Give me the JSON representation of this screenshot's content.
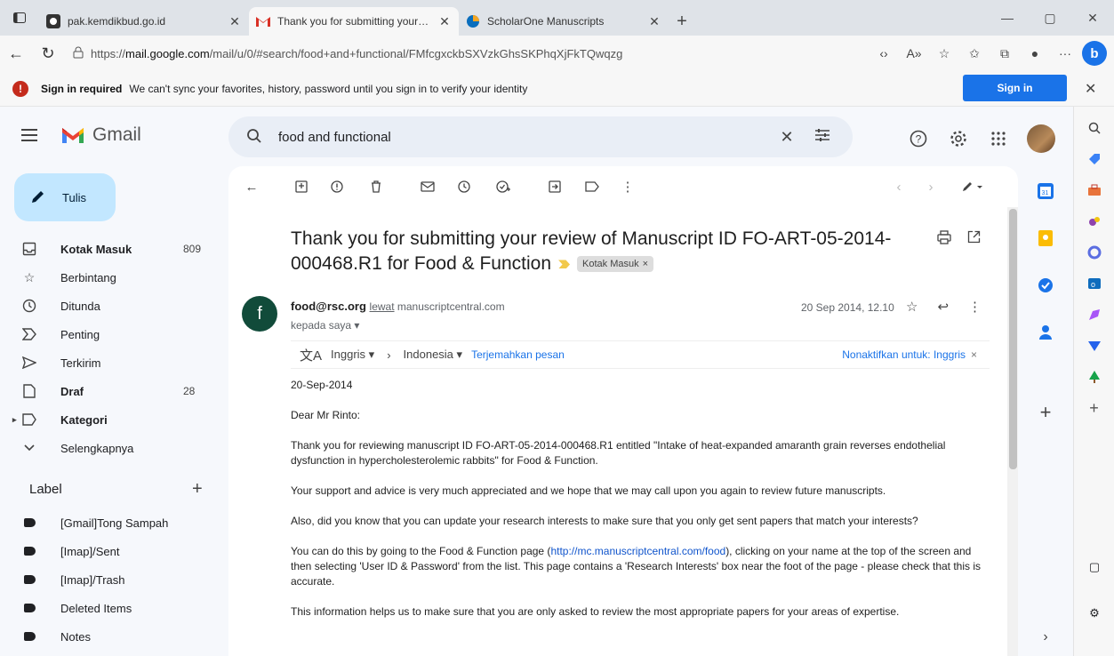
{
  "browser": {
    "tabs": [
      {
        "title": "pak.kemdikbud.go.id",
        "active": false
      },
      {
        "title": "Thank you for submitting your review of Manuscript",
        "active": true
      },
      {
        "title": "ScholarOne Manuscripts",
        "active": false
      }
    ],
    "url_prefix": "https://",
    "url_host": "mail.google.com",
    "url_path": "/mail/u/0/#search/food+and+functional/FMfcgxckbSXVzkGhsSKPhqXjFkTQwqzg"
  },
  "infobar": {
    "title": "Sign in required",
    "message": "We can't sync your favorites, history, password until you sign in to verify your identity",
    "button": "Sign in"
  },
  "gmail": {
    "logo_text": "Gmail",
    "search_value": "food and functional",
    "compose_label": "Tulis",
    "nav": [
      {
        "label": "Kotak Masuk",
        "count": "809",
        "bold": true
      },
      {
        "label": "Berbintang",
        "count": "",
        "bold": false
      },
      {
        "label": "Ditunda",
        "count": "",
        "bold": false
      },
      {
        "label": "Penting",
        "count": "",
        "bold": false
      },
      {
        "label": "Terkirim",
        "count": "",
        "bold": false
      },
      {
        "label": "Draf",
        "count": "28",
        "bold": true
      },
      {
        "label": "Kategori",
        "count": "",
        "bold": true
      },
      {
        "label": "Selengkapnya",
        "count": "",
        "bold": false
      }
    ],
    "label_heading": "Label",
    "labels": [
      "[Gmail]Tong Sampah",
      "[Imap]/Sent",
      "[Imap]/Trash",
      "Deleted Items",
      "Notes"
    ]
  },
  "message": {
    "subject_line1": "Thank you for submitting your review of Manuscript ID FO-ART-05-2014-",
    "subject_line2": "000468.R1 for Food & Function",
    "chip": "Kotak Masuk",
    "sender_avatar_letter": "f",
    "sender_email": "food@rsc.org",
    "via_label": "lewat",
    "via_domain": "manuscriptcentral.com",
    "to": "kepada saya",
    "date": "20 Sep 2014, 12.10",
    "translate": {
      "from": "Inggris",
      "to": "Indonesia",
      "action": "Terjemahkan pesan",
      "off": "Nonaktifkan untuk: Inggris"
    },
    "body": {
      "date_line": "20-Sep-2014",
      "greeting": "Dear Mr Rinto:",
      "p1": "Thank you for reviewing manuscript ID FO-ART-05-2014-000468.R1 entitled \"Intake of heat-expanded amaranth grain reverses endothelial dysfunction in hypercholesterolemic rabbits\" for Food & Function.",
      "p2": "Your support and advice is very much appreciated and we hope that we may call upon you again to review future manuscripts.",
      "p3": "Also, did you know that you can update your research interests to make sure that you only get sent papers that match your interests?",
      "p4_a": "You can do this by going to the Food & Function page (",
      "p4_link": "http://mc.manuscriptcentral.com/food",
      "p4_b": "), clicking on your name at the top of the screen and then selecting 'User ID & Password' from the list. This page contains a 'Research Interests' box near the foot of the page - please check that this is accurate.",
      "p5": "This information helps us to make sure that you are only asked to review the most appropriate papers for your areas of expertise."
    }
  },
  "colors": {
    "compose_bg": "#c2e7ff",
    "search_bg": "#e9eef6",
    "signin_bg": "#1a73e8",
    "sender_avatar_bg": "#114b3a",
    "important_marker": "#f2c94c"
  }
}
